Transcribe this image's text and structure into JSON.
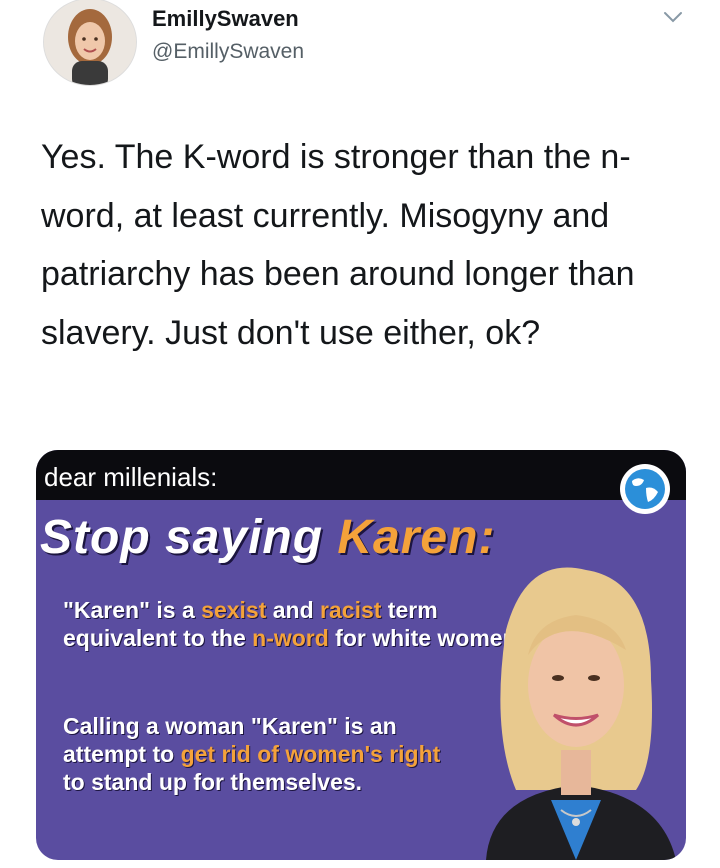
{
  "author": {
    "name": "EmillySwaven",
    "handle": "@EmillySwaven"
  },
  "tweet": {
    "text": "Yes. The K-word is stronger than the n-word, at least currently. Misogyny and patriarchy has been around longer than slavery. Just don't use either, ok?"
  },
  "card": {
    "top_label": "dear millenials:",
    "headline_part1": "Stop saying ",
    "headline_part2": "Karen",
    "headline_part3": ":",
    "paragraph1": {
      "t1": "\"Karen\" is a ",
      "h1": "sexist",
      "t2": " and ",
      "h2": "racist",
      "t3": " term equivalent to the ",
      "h3": "n-word",
      "t4": " for white women."
    },
    "paragraph2": {
      "t1": "Calling a woman \"Karen\" is an attempt to ",
      "h1": "get rid of women's right",
      "t2": " to stand up for themselves."
    }
  },
  "colors": {
    "card_background": "#5a4da0",
    "highlight": "#f4a23a"
  },
  "icons": {
    "more": "chevron-down-icon",
    "globe": "globe-icon"
  }
}
